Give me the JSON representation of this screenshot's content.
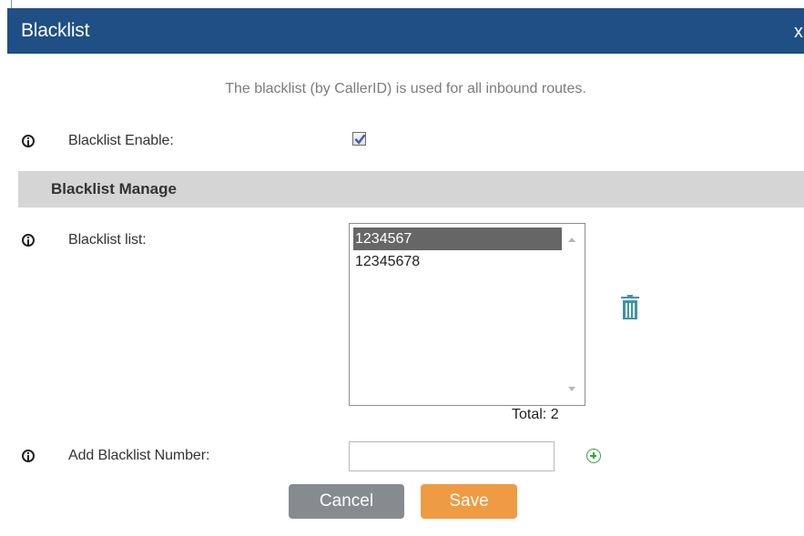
{
  "dialog": {
    "title": "Blacklist",
    "close_label": "x",
    "description": "The blacklist (by CallerID) is used for all inbound routes."
  },
  "fields": {
    "enable_label": "Blacklist Enable:",
    "enable_checked": true,
    "list_label": "Blacklist list:",
    "add_label": "Add Blacklist Number:",
    "add_value": "",
    "add_placeholder": ""
  },
  "section": {
    "title": "Blacklist Manage"
  },
  "blacklist": {
    "items": [
      {
        "number": "1234567",
        "selected": true
      },
      {
        "number": "12345678",
        "selected": false
      }
    ],
    "total_text": "Total: 2"
  },
  "buttons": {
    "cancel_label": "Cancel",
    "save_label": "Save"
  },
  "icons": {
    "info": "info-icon",
    "delete": "trash-icon",
    "add": "add-circle-icon",
    "checkmark": "checkmark-icon"
  },
  "colors": {
    "titlebar": "#1f4f84",
    "section_header": "#d5d5d5",
    "cancel_button": "#878b90",
    "save_button": "#ee9b43",
    "trash_icon": "#3f93a3",
    "add_icon": "#33a33b",
    "selected_row": "#666666"
  }
}
